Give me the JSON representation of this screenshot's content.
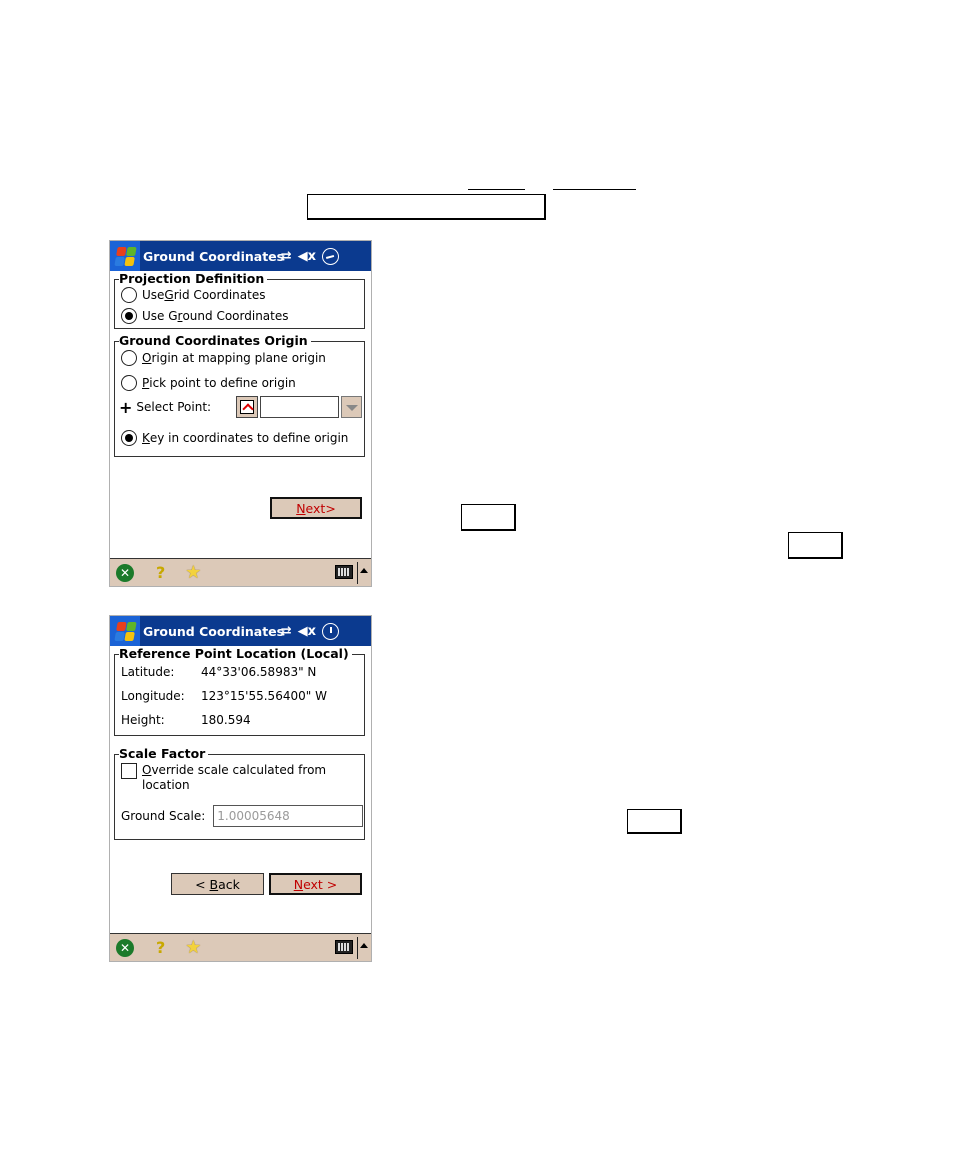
{
  "screens": [
    {
      "title": "Ground Coordinates",
      "projection_group": {
        "label": "Projection Definition",
        "options": [
          {
            "pre": "Use ",
            "ul": "G",
            "post": "rid Coordinates",
            "selected": false
          },
          {
            "pre": "Use G",
            "ul": "r",
            "post": "ound Coordinates",
            "selected": true
          }
        ]
      },
      "origin_group": {
        "label": "Ground Coordinates Origin",
        "options": [
          {
            "pre": "",
            "ul": "O",
            "post": "rigin at mapping plane origin",
            "selected": false
          },
          {
            "pre": "",
            "ul": "P",
            "post": "ick point to define origin",
            "selected": false
          },
          {
            "pre": "",
            "ul": "K",
            "post": "ey in coordinates to define origin",
            "selected": true
          }
        ],
        "select_point_label": "Select Point:",
        "select_point_value": ""
      },
      "next_button": {
        "ul": "N",
        "post": "ext>"
      }
    },
    {
      "title": "Ground Coordinates",
      "reference_group": {
        "label": "Reference Point Location (Local)",
        "rows": [
          {
            "label": "Latitude:",
            "value": "44°33'06.58983\" N"
          },
          {
            "label": "Longitude:",
            "value": "123°15'55.56400\" W"
          },
          {
            "label": "Height:",
            "value": "180.594"
          }
        ]
      },
      "scale_group": {
        "label": "Scale Factor",
        "override": {
          "ul": "O",
          "line1": "verride scale calculated from",
          "line2": "location",
          "checked": false
        },
        "ground_scale_label": "Ground Scale:",
        "ground_scale_value": "1.00005648"
      },
      "back_button": {
        "pre": "< ",
        "ul": "B",
        "post": "ack"
      },
      "next_button": {
        "ul": "N",
        "post": "ext >"
      }
    }
  ],
  "taskbar": {
    "ok_icon": "✕",
    "help_icon": "?",
    "favorites_icon": "★"
  },
  "colors": {
    "titlebar": "#0b3a8f",
    "button_face": "#dcc9b8",
    "default_button_text": "#c00000"
  }
}
